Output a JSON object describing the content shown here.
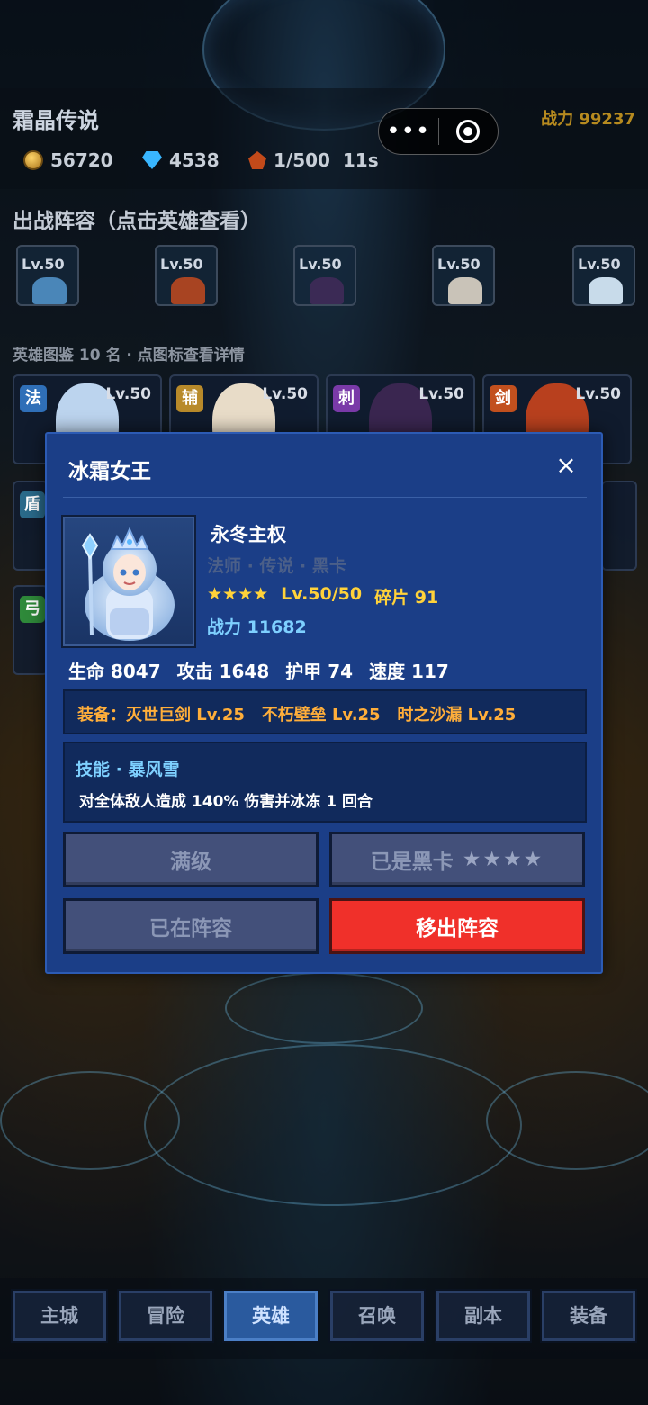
{
  "header": {
    "game_title": "霜晶传说",
    "power": "战力 99237",
    "resources": {
      "coins": "56720",
      "gems": "4538",
      "stamina": "1/500  11s"
    }
  },
  "capsule": {
    "more": "•••",
    "target_icon": "target-icon"
  },
  "lineup": {
    "title": "出战阵容（点击英雄查看）",
    "slots": [
      {
        "level": "Lv.50"
      },
      {
        "level": "Lv.50"
      },
      {
        "level": "Lv.50"
      },
      {
        "level": "Lv.50"
      },
      {
        "level": "Lv.50"
      }
    ]
  },
  "codex": {
    "hint": "英雄图鉴 10 名 · 点图标查看详情",
    "cards": [
      {
        "role": "法",
        "level": "Lv.50",
        "role_color": "#2f6fb8"
      },
      {
        "role": "辅",
        "level": "Lv.50",
        "role_color": "#b88a2a"
      },
      {
        "role": "刺",
        "level": "Lv.50",
        "role_color": "#7a3aa8"
      },
      {
        "role": "剑",
        "level": "Lv.50",
        "role_color": "#c2501e"
      }
    ],
    "side_roles": [
      "盾",
      "弓"
    ]
  },
  "modal": {
    "title": "冰霜女王",
    "close": "×",
    "hero": {
      "name": "永冬主权",
      "class": "法师 · 传说 · 黑卡",
      "stars": "★★★★",
      "level": "Lv.50/50",
      "shards": "碎片 91",
      "power": "战力 11682"
    },
    "stats": {
      "hp": "生命 8047",
      "atk": "攻击 1648",
      "armor": "护甲 74",
      "speed": "速度 117"
    },
    "equipment": "装备：灭世巨剑 Lv.25   不朽壁垒 Lv.25   时之沙漏 Lv.25",
    "skill": {
      "name": "技能 · 暴风雪",
      "desc": "对全体敌人造成 140% 伤害并冰冻 1 回合"
    },
    "buttons": {
      "max_level": "满级",
      "black_card": "已是黑卡",
      "black_card_stars": "★★★★",
      "in_lineup": "已在阵容",
      "remove": "移出阵容"
    }
  },
  "nav": {
    "items": [
      {
        "label": "主城"
      },
      {
        "label": "冒险"
      },
      {
        "label": "英雄"
      },
      {
        "label": "召唤"
      },
      {
        "label": "副本"
      },
      {
        "label": "装备"
      }
    ],
    "active": "英雄"
  },
  "colors": {
    "modal_bg": "#1b3e87",
    "accent_red": "#f0302a",
    "gold": "#ffd23a",
    "cyan": "#7ed0ff",
    "orange": "#ffae3a"
  }
}
